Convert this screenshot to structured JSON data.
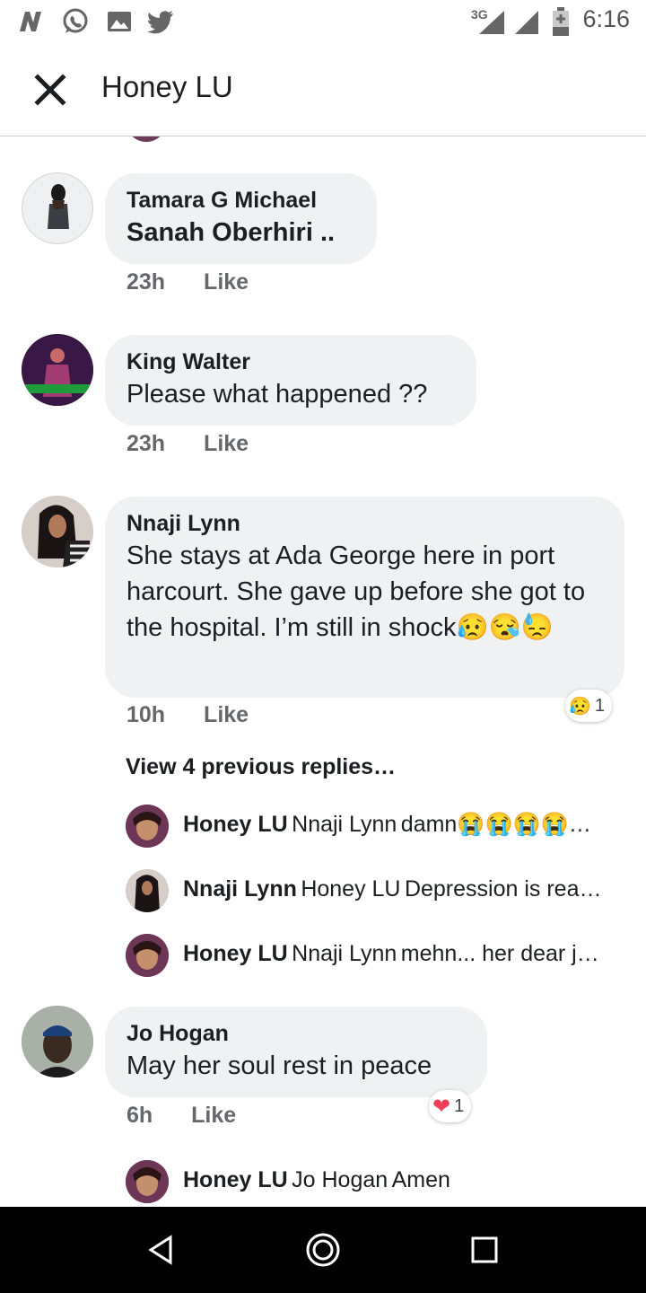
{
  "status_bar": {
    "time": "6:16",
    "network": "3G",
    "icons": [
      "n-icon",
      "whatsapp-icon",
      "gallery-icon",
      "twitter-icon",
      "signal-icon",
      "signal-icon",
      "battery-icon"
    ]
  },
  "app_bar": {
    "title": "Honey LU"
  },
  "comments": [
    {
      "author": "Tamara G Michael",
      "text": "Sanah Oberhiri ..",
      "text_bold": true,
      "time": "23h",
      "like": "Like"
    },
    {
      "author": "King Walter",
      "text": "Please what happened ??",
      "time": "23h",
      "like": "Like"
    },
    {
      "author": "Nnaji Lynn",
      "text": "She stays at Ada George here in port harcourt. She gave up before she got to the hospital. I’m still in shock😥😪😓",
      "time": "10h",
      "like": "Like",
      "reaction": {
        "emoji": "😥",
        "count": "1"
      }
    },
    {
      "author": "Jo Hogan",
      "text": "May her soul rest in peace",
      "time": "6h",
      "like": "Like",
      "reaction": {
        "emoji": "❤",
        "count": "1"
      }
    }
  ],
  "replies_thread": {
    "view_more": "View 4 previous replies…",
    "replies": [
      {
        "author": "Honey LU",
        "mention": "Nnaji Lynn",
        "text": "damn😭😭😭😭…"
      },
      {
        "author": "Nnaji Lynn",
        "mention": "Honey LU",
        "text": "Depression is rea…"
      },
      {
        "author": "Honey LU",
        "mention": "Nnaji Lynn",
        "text": "mehn... her dear j…"
      }
    ]
  },
  "last_reply": {
    "author": "Honey LU",
    "mention": "Jo Hogan",
    "text": "Amen"
  },
  "colors": {
    "bubble": "#eff1f3",
    "meta": "#65676b",
    "heart": "#f33e58"
  }
}
